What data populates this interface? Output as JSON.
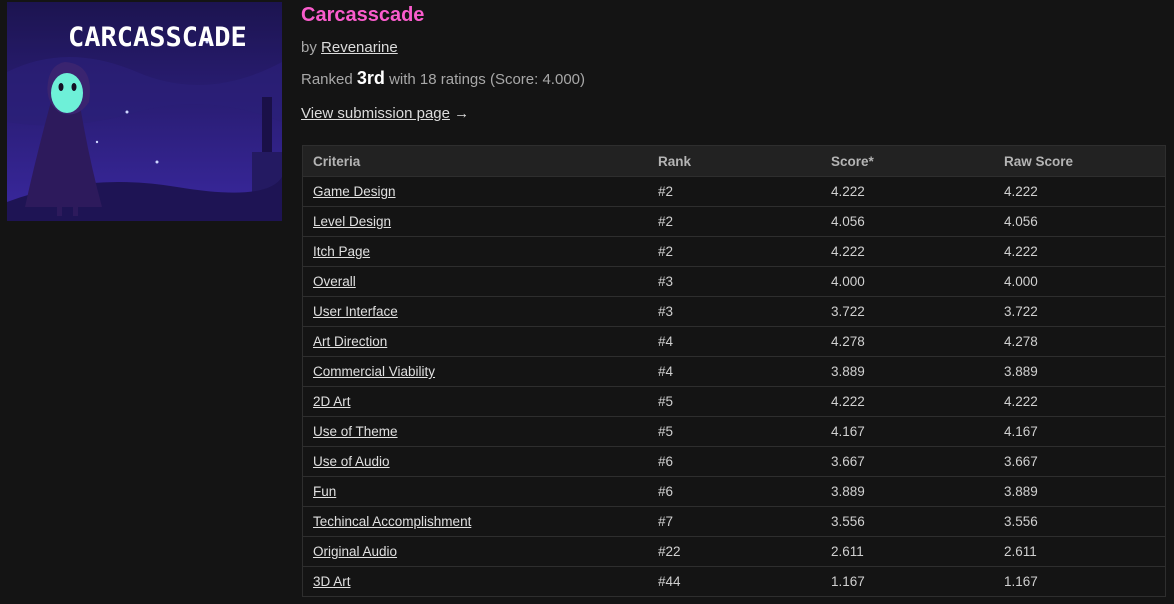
{
  "cover": {
    "logo_text": "CARCASSCADE"
  },
  "game": {
    "title": "Carcasscade",
    "by_prefix": "by",
    "author": "Revenarine",
    "ranked_prefix": "Ranked",
    "place": "3rd",
    "ratings_text": "with 18 ratings (Score: 4.000)",
    "view_link": "View submission page",
    "view_arrow": "→"
  },
  "table": {
    "headers": [
      "Criteria",
      "Rank",
      "Score*",
      "Raw Score"
    ],
    "rows": [
      {
        "criteria": "Game Design",
        "rank": "#2",
        "score": "4.222",
        "raw": "4.222"
      },
      {
        "criteria": "Level Design",
        "rank": "#2",
        "score": "4.056",
        "raw": "4.056"
      },
      {
        "criteria": "Itch Page",
        "rank": "#2",
        "score": "4.222",
        "raw": "4.222"
      },
      {
        "criteria": "Overall",
        "rank": "#3",
        "score": "4.000",
        "raw": "4.000"
      },
      {
        "criteria": "User Interface",
        "rank": "#3",
        "score": "3.722",
        "raw": "3.722"
      },
      {
        "criteria": "Art Direction",
        "rank": "#4",
        "score": "4.278",
        "raw": "4.278"
      },
      {
        "criteria": "Commercial Viability",
        "rank": "#4",
        "score": "3.889",
        "raw": "3.889"
      },
      {
        "criteria": "2D Art",
        "rank": "#5",
        "score": "4.222",
        "raw": "4.222"
      },
      {
        "criteria": "Use of Theme",
        "rank": "#5",
        "score": "4.167",
        "raw": "4.167"
      },
      {
        "criteria": "Use of Audio",
        "rank": "#6",
        "score": "3.667",
        "raw": "3.667"
      },
      {
        "criteria": "Fun",
        "rank": "#6",
        "score": "3.889",
        "raw": "3.889"
      },
      {
        "criteria": "Techincal Accomplishment",
        "rank": "#7",
        "score": "3.556",
        "raw": "3.556"
      },
      {
        "criteria": "Original Audio",
        "rank": "#22",
        "score": "2.611",
        "raw": "2.611"
      },
      {
        "criteria": "3D Art",
        "rank": "#44",
        "score": "1.167",
        "raw": "1.167"
      }
    ]
  },
  "colors": {
    "background": "#141414",
    "title_accent": "#fa5ccc",
    "header_bg": "#222222"
  }
}
